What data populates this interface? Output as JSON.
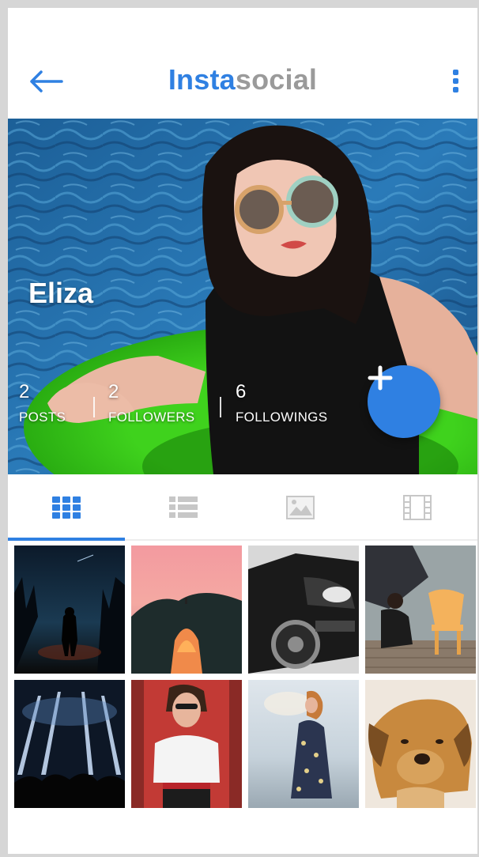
{
  "app": {
    "title_part1": "Insta",
    "title_part2": "social",
    "brand_color": "#2f80e2",
    "secondary_color": "#9a9a9a"
  },
  "profile": {
    "name": "Eliza",
    "stats": [
      {
        "value": "2",
        "label": "POSTS"
      },
      {
        "value": "2",
        "label": "FOLLOWERS"
      },
      {
        "value": "6",
        "label": "FOLLOWINGS"
      }
    ]
  },
  "icons": {
    "back": "arrow-left-icon",
    "more": "more-vertical-icon",
    "add": "plus-icon",
    "tabs": [
      "grid-icon",
      "list-icon",
      "image-icon",
      "film-icon"
    ]
  },
  "tabs": {
    "active_index": 0
  },
  "photos": [
    "silhouette-night",
    "rock-arch-sunset",
    "black-car",
    "man-orange-chair",
    "concert-lights",
    "woman-white-tshirt",
    "woman-floral-dress",
    "puppy"
  ]
}
